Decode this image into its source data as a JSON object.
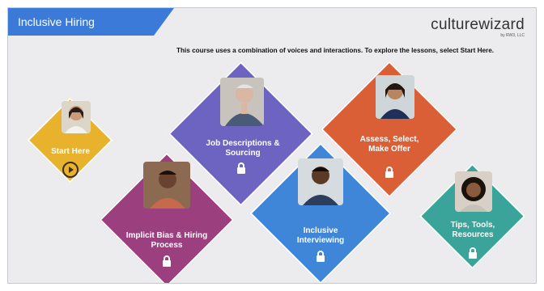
{
  "header": {
    "tab_title": "Inclusive Hiring",
    "brand_name": "culturewizard",
    "brand_sub": "by RW3, LLC",
    "instructions": "This course uses a combination of voices and interactions. To explore the lessons, select Start Here."
  },
  "colors": {
    "tab": "#3c7ad9",
    "start": "#e9b22c",
    "bias": "#9c3f7e",
    "job": "#6c64c0",
    "interview": "#3f86d9",
    "assess": "#db5f36",
    "tips": "#3aa39a"
  },
  "tiles": [
    {
      "label": "Start Here",
      "icon": "play-circle-icon"
    },
    {
      "label": "Job Descriptions & Sourcing",
      "icon": "lock-icon"
    },
    {
      "label": "Assess, Select, Make Offer",
      "icon": "lock-icon"
    },
    {
      "label": "Implicit Bias & Hiring Process",
      "icon": "lock-icon"
    },
    {
      "label": "Inclusive Interviewing",
      "icon": "lock-icon"
    },
    {
      "label": "Tips, Tools, Resources",
      "icon": "lock-icon"
    }
  ]
}
